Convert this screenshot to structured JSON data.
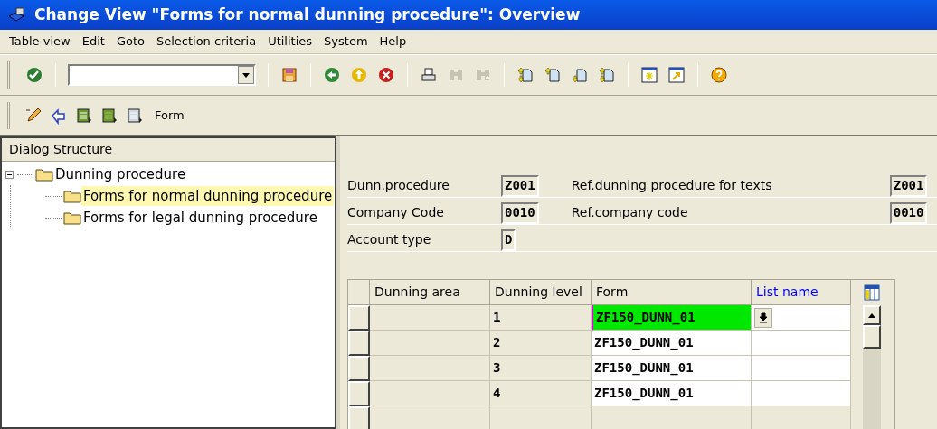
{
  "window": {
    "title": "Change View \"Forms for normal dunning procedure\": Overview"
  },
  "menu": [
    "Table view",
    "Edit",
    "Goto",
    "Selection criteria",
    "Utilities",
    "System",
    "Help"
  ],
  "standard_toolbar": [
    {
      "kind": "enter",
      "disabled": false
    },
    {
      "kind": "command_field",
      "disabled": false
    },
    {
      "kind": "save",
      "disabled": false
    },
    {
      "kind": "back",
      "disabled": false
    },
    {
      "kind": "exit",
      "disabled": false
    },
    {
      "kind": "cancel",
      "disabled": false
    },
    {
      "kind": "print",
      "disabled": false
    },
    {
      "kind": "find",
      "disabled": true
    },
    {
      "kind": "find_next",
      "disabled": true
    },
    {
      "kind": "first_page",
      "disabled": false
    },
    {
      "kind": "prev_page",
      "disabled": false
    },
    {
      "kind": "next_page",
      "disabled": false
    },
    {
      "kind": "last_page",
      "disabled": false
    },
    {
      "kind": "new_session",
      "disabled": false
    },
    {
      "kind": "shortcut",
      "disabled": false
    },
    {
      "kind": "help",
      "disabled": false
    }
  ],
  "app_toolbar": [
    {
      "kind": "edit"
    },
    {
      "kind": "undo"
    },
    {
      "kind": "select_all"
    },
    {
      "kind": "select_block"
    },
    {
      "kind": "deselect_all"
    },
    {
      "kind": "text",
      "label": "Form"
    }
  ],
  "dialog_structure": {
    "title": "Dialog Structure",
    "nodes": [
      {
        "label": "Dunning procedure",
        "expanded": true,
        "selected": false,
        "children": [
          {
            "label": "Forms for normal dunning procedure",
            "selected": true
          },
          {
            "label": "Forms for legal dunning procedure",
            "selected": false
          }
        ]
      }
    ]
  },
  "header_fields": [
    {
      "label": "Dunn.procedure",
      "value": "Z001",
      "ref_label": "Ref.dunning procedure for texts",
      "ref_value": "Z001"
    },
    {
      "label": "Company Code",
      "value": "0010",
      "ref_label": "Ref.company code",
      "ref_value": "0010"
    },
    {
      "label": "Account type",
      "value": "D"
    }
  ],
  "table": {
    "columns": [
      {
        "label": "Dunning area",
        "editable": false,
        "color": "#000000"
      },
      {
        "label": "Dunning level",
        "editable": false,
        "color": "#000000"
      },
      {
        "label": "Form",
        "editable": true,
        "color": "#000000"
      },
      {
        "label": "List name",
        "editable": true,
        "color": "#0000ff"
      }
    ],
    "rows": [
      {
        "cells": [
          "",
          "1",
          "ZF150_DUNN_01",
          ""
        ],
        "focused": true
      },
      {
        "cells": [
          "",
          "2",
          "ZF150_DUNN_01",
          ""
        ],
        "focused": false
      },
      {
        "cells": [
          "",
          "3",
          "ZF150_DUNN_01",
          ""
        ],
        "focused": false
      },
      {
        "cells": [
          "",
          "4",
          "ZF150_DUNN_01",
          ""
        ],
        "focused": false
      }
    ]
  }
}
